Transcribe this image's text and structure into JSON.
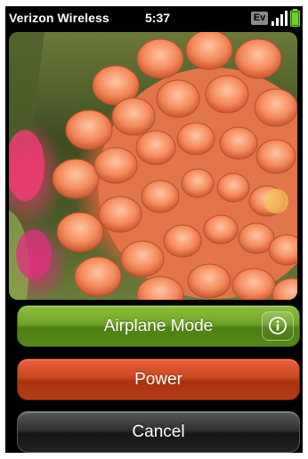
{
  "status_bar": {
    "carrier": "Verizon Wireless",
    "time": "5:37",
    "network_badge": "Ev",
    "signal_icon": "signal-bars-icon",
    "battery_icon": "battery-icon"
  },
  "dialog": {
    "buttons": {
      "airplane_mode": "Airplane Mode",
      "power": "Power",
      "cancel": "Cancel"
    },
    "info_icon": "info-icon"
  },
  "colors": {
    "airplane_green": "#6ea326",
    "power_red": "#c9461e",
    "cancel_dark": "#2f2f2f"
  }
}
